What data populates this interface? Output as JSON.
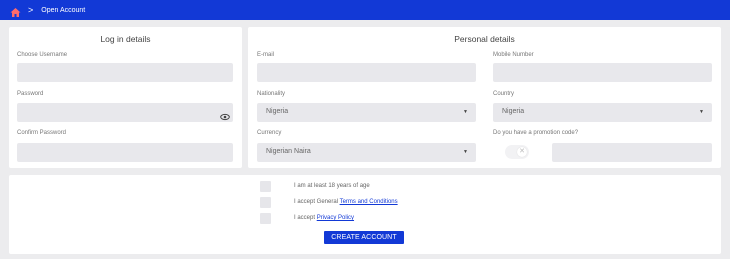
{
  "breadcrumb": {
    "chevron": ">",
    "current": "Open Account"
  },
  "login": {
    "title": "Log in details",
    "username_label": "Choose Username",
    "password_label": "Password",
    "confirm_label": "Confirm Password"
  },
  "personal": {
    "title": "Personal details",
    "email_label": "E-mail",
    "mobile_label": "Mobile Number",
    "nationality_label": "Nationality",
    "nationality_value": "Nigeria",
    "country_label": "Country",
    "country_value": "Nigeria",
    "currency_label": "Currency",
    "currency_value": "Nigerian Naira",
    "promo_label": "Do you have a promotion code?",
    "caret": "▼"
  },
  "agreements": {
    "age": "I am at least 18 years of age",
    "terms_prefix": "I accept General ",
    "terms_link": "Terms and Conditions",
    "privacy_prefix": "I accept ",
    "privacy_link": "Privacy Policy"
  },
  "create_button": "CREATE ACCOUNT",
  "colors": {
    "brand": "#1239d6",
    "field": "#e8e8ec",
    "background": "#ececee"
  },
  "icons": {
    "home": "home-icon",
    "eye": "eye-icon",
    "toggle_off": "close-icon"
  }
}
